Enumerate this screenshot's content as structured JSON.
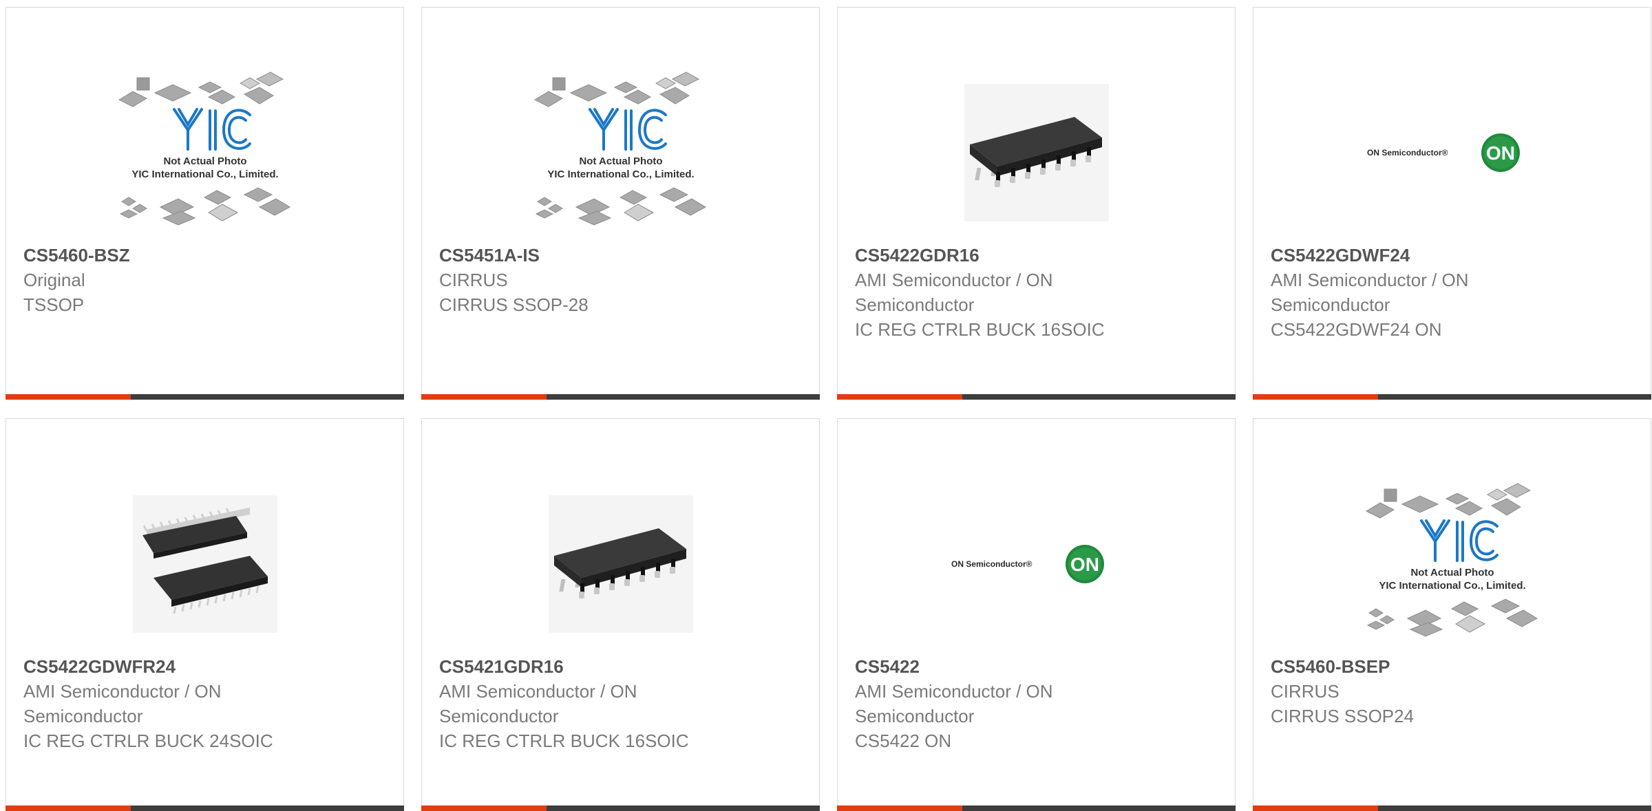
{
  "products": [
    {
      "part": "CS5460-BSZ",
      "maker": "Original",
      "desc": "TSSOP",
      "image": "yic-placeholder",
      "photo_line1": "Not Actual Photo",
      "photo_line2": "YIC International Co., Limited.",
      "logo_text": "YIC"
    },
    {
      "part": "CS5451A-IS",
      "maker": "CIRRUS",
      "desc": "CIRRUS SSOP-28",
      "image": "yic-placeholder",
      "photo_line1": "Not Actual Photo",
      "photo_line2": "YIC International Co., Limited.",
      "logo_text": "YIC"
    },
    {
      "part": "CS5422GDR16",
      "maker": "AMI Semiconductor / ON Semiconductor",
      "desc": "IC REG CTRLR BUCK 16SOIC",
      "image": "soic-chip"
    },
    {
      "part": "CS5422GDWF24",
      "maker": "AMI Semiconductor / ON Semiconductor",
      "desc": "CS5422GDWF24 ON",
      "image": "on-semi-logo",
      "logo_name": "ON Semiconductor®",
      "logo_badge": "ON"
    },
    {
      "part": "CS5422GDWFR24",
      "maker": "AMI Semiconductor / ON Semiconductor",
      "desc": "IC REG CTRLR BUCK 24SOIC",
      "image": "soic-chip-pair"
    },
    {
      "part": "CS5421GDR16",
      "maker": "AMI Semiconductor / ON Semiconductor",
      "desc": "IC REG CTRLR BUCK 16SOIC",
      "image": "soic-chip"
    },
    {
      "part": "CS5422",
      "maker": "AMI Semiconductor / ON Semiconductor",
      "desc": "CS5422 ON",
      "image": "on-semi-logo",
      "logo_name": "ON Semiconductor®",
      "logo_badge": "ON"
    },
    {
      "part": "CS5460-BSEP",
      "maker": "CIRRUS",
      "desc": "CIRRUS SSOP24",
      "image": "yic-placeholder",
      "photo_line1": "Not Actual Photo",
      "photo_line2": "YIC International Co., Limited.",
      "logo_text": "YIC"
    }
  ],
  "colors": {
    "accent": "#e23c12",
    "bar": "#3d3d3d",
    "on_green": "#1f8a3b",
    "yic_blue": "#1b78c8"
  }
}
